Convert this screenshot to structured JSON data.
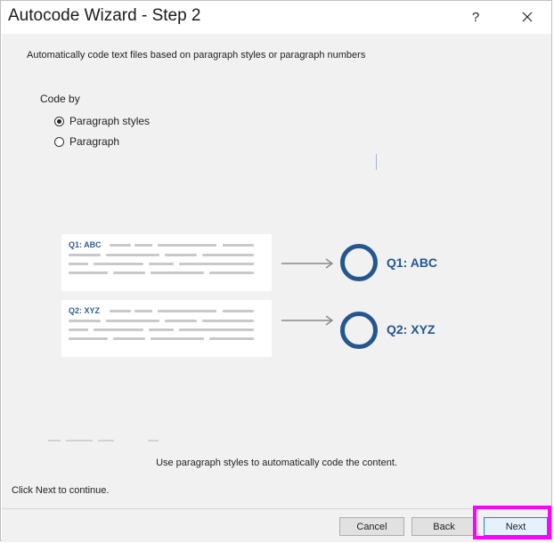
{
  "window": {
    "title": "Autocode Wizard - Step 2",
    "help_label": "?"
  },
  "description": "Automatically code text files based on paragraph styles or paragraph numbers",
  "code_by": {
    "label": "Code by",
    "options": [
      {
        "label": "Paragraph styles",
        "selected": true
      },
      {
        "label": "Paragraph",
        "selected": false
      }
    ]
  },
  "illustration": {
    "cards": [
      {
        "heading": "Q1: ABC",
        "code": "Q1: ABC"
      },
      {
        "heading": "Q2: XYZ",
        "code": "Q2: XYZ"
      }
    ]
  },
  "hint": "Use paragraph styles to automatically code the content.",
  "continue_text": "Click Next to continue.",
  "buttons": {
    "cancel": "Cancel",
    "back": "Back",
    "next": "Next"
  },
  "colors": {
    "accent": "#24578f",
    "highlight": "#ff00ff"
  }
}
